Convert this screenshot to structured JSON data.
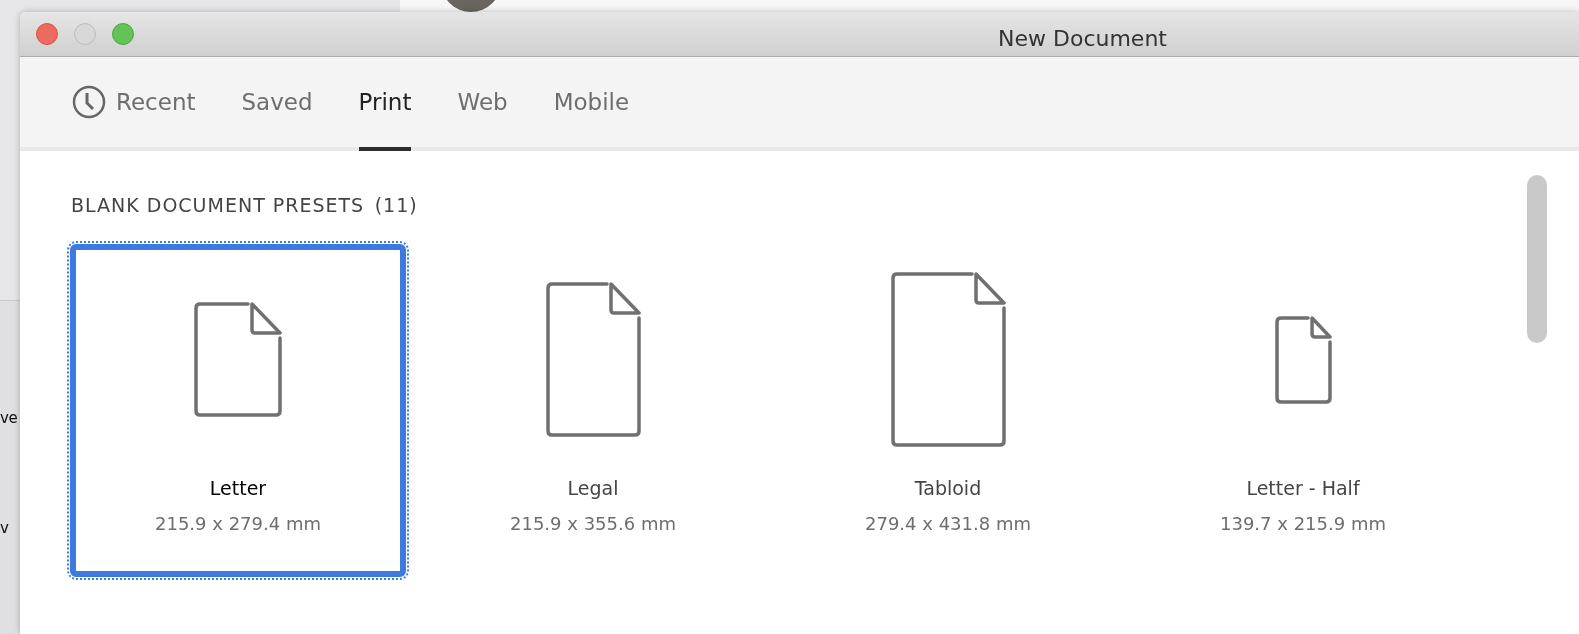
{
  "background": {
    "texts": [
      "ve",
      "v"
    ]
  },
  "window": {
    "title": "New Document"
  },
  "tabs": [
    {
      "label": "Recent",
      "selected": false,
      "kind": "icon"
    },
    {
      "label": "Saved",
      "selected": false,
      "kind": "text"
    },
    {
      "label": "Print",
      "selected": true,
      "kind": "text"
    },
    {
      "label": "Web",
      "selected": false,
      "kind": "text"
    },
    {
      "label": "Mobile",
      "selected": false,
      "kind": "text"
    }
  ],
  "section": {
    "title": "BLANK DOCUMENT PRESETS",
    "count": "(11)"
  },
  "presets": [
    {
      "name": "Letter",
      "size": "215.9 x 279.4 mm",
      "selected": true
    },
    {
      "name": "Legal",
      "size": "215.9 x 355.6 mm",
      "selected": false
    },
    {
      "name": "Tabloid",
      "size": "279.4 x 431.8 mm",
      "selected": false
    },
    {
      "name": "Letter - Half",
      "size": "139.7 x 215.9 mm",
      "selected": false
    }
  ]
}
